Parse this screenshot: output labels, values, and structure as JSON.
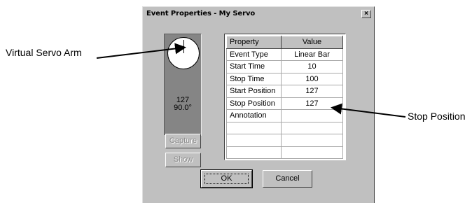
{
  "callouts": {
    "servo_arm": "Virtual Servo Arm",
    "stop_position": "Stop Position"
  },
  "dialog": {
    "title": "Event Properties - My Servo",
    "close_glyph": "×"
  },
  "servo": {
    "value": "127",
    "angle": "90.0°"
  },
  "buttons": {
    "capture": "Capture",
    "show": "Show",
    "ok": "OK",
    "cancel": "Cancel"
  },
  "grid": {
    "headers": [
      "Property",
      "Value"
    ],
    "rows": [
      {
        "property": "Event Type",
        "value": "Linear Bar"
      },
      {
        "property": "Start Time",
        "value": "10"
      },
      {
        "property": "Stop Time",
        "value": "100"
      },
      {
        "property": "Start Position",
        "value": "127"
      },
      {
        "property": "Stop Position",
        "value": "127"
      },
      {
        "property": "Annotation",
        "value": ""
      },
      {
        "property": "",
        "value": ""
      },
      {
        "property": "",
        "value": ""
      },
      {
        "property": "",
        "value": ""
      }
    ]
  },
  "colors": {
    "dialog_bg": "#c0c0c0",
    "servo_panel_bg": "#858585",
    "dial_fill": "#ffffff"
  }
}
